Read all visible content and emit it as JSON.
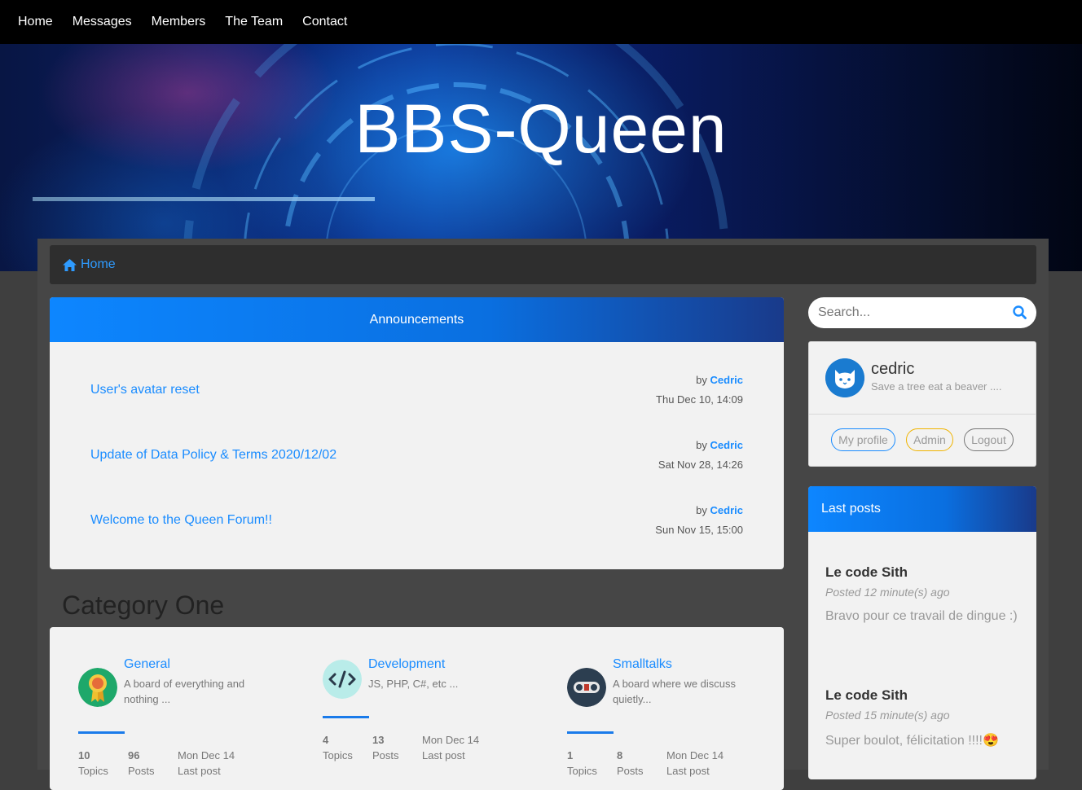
{
  "nav": {
    "items": [
      "Home",
      "Messages",
      "Members",
      "The Team",
      "Contact"
    ]
  },
  "banner": {
    "title": "BBS-Queen"
  },
  "breadcrumb": {
    "home": "Home"
  },
  "announcements": {
    "header": "Announcements",
    "items": [
      {
        "title": "User's avatar reset",
        "by": "by",
        "author": "Cedric",
        "date": "Thu Dec 10, 14:09"
      },
      {
        "title": "Update of Data Policy & Terms 2020/12/02",
        "by": "by",
        "author": "Cedric",
        "date": "Sat Nov 28, 14:26"
      },
      {
        "title": "Welcome to the Queen Forum!!",
        "by": "by",
        "author": "Cedric",
        "date": "Sun Nov 15, 15:00"
      }
    ]
  },
  "category": {
    "title": "Category One",
    "boards": [
      {
        "name": "General",
        "desc": "A board of everything and nothing ...",
        "topics": "10",
        "topics_label": "Topics",
        "posts": "96",
        "posts_label": "Posts",
        "last": "Mon Dec 14",
        "last_label": "Last post",
        "icon": "award-ribbon-icon"
      },
      {
        "name": "Development",
        "desc": "JS, PHP, C#, etc ...",
        "topics": "4",
        "topics_label": "Topics",
        "posts": "13",
        "posts_label": "Posts",
        "last": "Mon Dec 14",
        "last_label": "Last post",
        "icon": "code-icon"
      },
      {
        "name": "Smalltalks",
        "desc": "A board where we discuss quietly...",
        "topics": "1",
        "topics_label": "Topics",
        "posts": "8",
        "posts_label": "Posts",
        "last": "Mon Dec 14",
        "last_label": "Last post",
        "icon": "robot-face-icon"
      }
    ]
  },
  "search": {
    "placeholder": "Search..."
  },
  "profile": {
    "username": "cedric",
    "motto": "Save a tree eat a beaver ....",
    "my_profile": "My profile",
    "admin": "Admin",
    "logout": "Logout"
  },
  "last_posts": {
    "header": "Last posts",
    "items": [
      {
        "title": "Le code Sith",
        "meta": "Posted 12 minute(s) ago",
        "body": "Bravo pour ce travail de dingue :)"
      },
      {
        "title": "Le code Sith",
        "meta": "Posted 15 minute(s) ago",
        "body": "Super boulot, félicitation !!!!😍"
      }
    ]
  },
  "colors": {
    "accent": "#1a8cff",
    "nav_bg": "#000000",
    "admin_border": "#f0b400"
  }
}
